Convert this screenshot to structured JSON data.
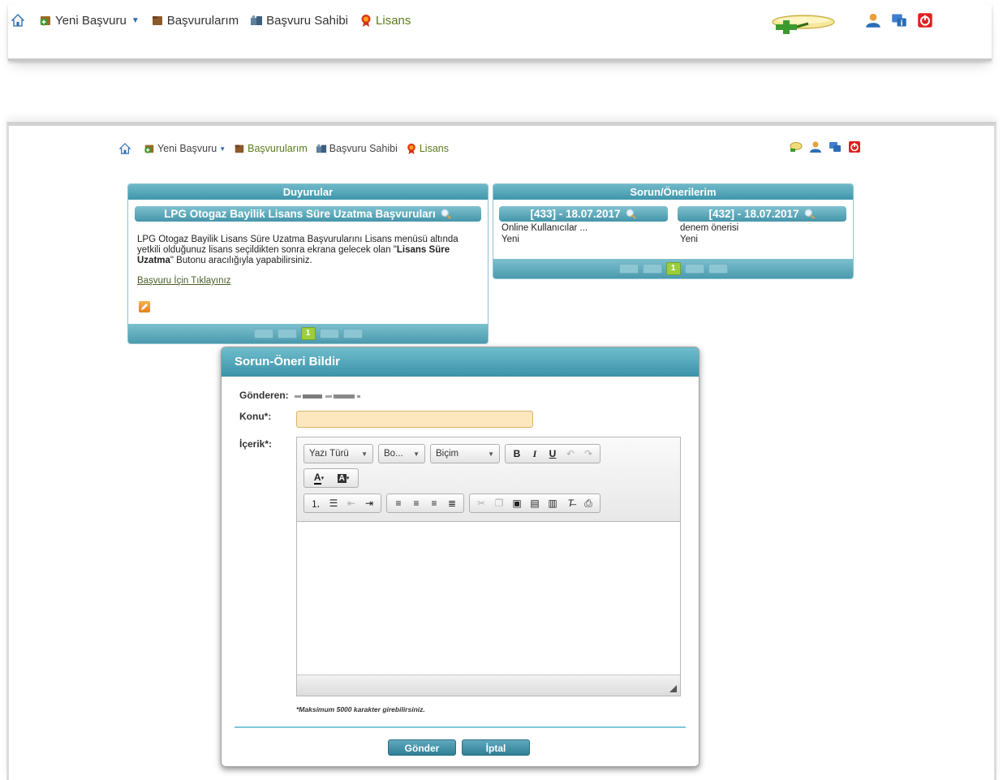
{
  "nav": {
    "new_application": "Yeni Başvuru",
    "my_applications": "Başvurularım",
    "applicant": "Başvuru Sahibi",
    "license": "Lisans"
  },
  "announcements": {
    "title": "Duyurular",
    "item_title": "LPG Otogaz Bayilik Lisans Süre Uzatma Başvuruları",
    "body_1": "LPG Otogaz Bayilik Lisans Süre Uzatma Başvurularını Lisans menüsü altında yetkili olduğunuz lisans seçildikten sonra ekrana gelecek olan \"",
    "body_bold": "Lisans Süre Uzatma",
    "body_2": "\" Butonu aracılığıyla yapabilirsiniz.",
    "link": "Başvuru İçin Tıklayınız",
    "page": "1"
  },
  "suggestions": {
    "title": "Sorun/Önerilerim",
    "items": [
      {
        "header": "[433] - 18.07.2017",
        "subject": "Online Kullanıcılar ...",
        "status": "Yeni"
      },
      {
        "header": "[432] - 18.07.2017",
        "subject": "denem önerisi",
        "status": "Yeni"
      }
    ],
    "page": "1"
  },
  "dialog": {
    "title": "Sorun-Öneri Bildir",
    "sender_label": "Gönderen:",
    "subject_label": "Konu*:",
    "content_label": "İçerik*:",
    "font_label": "Yazı Türü",
    "size_label": "Bo...",
    "format_label": "Biçim",
    "note": "*Maksimum 5000 karakter girebilirsiniz.",
    "send_button": "Gönder",
    "cancel_button": "İptal"
  },
  "colors": {
    "header_teal": "#3f96ab",
    "license_green": "#5d7a18",
    "page_active": "#9ccd3e"
  }
}
